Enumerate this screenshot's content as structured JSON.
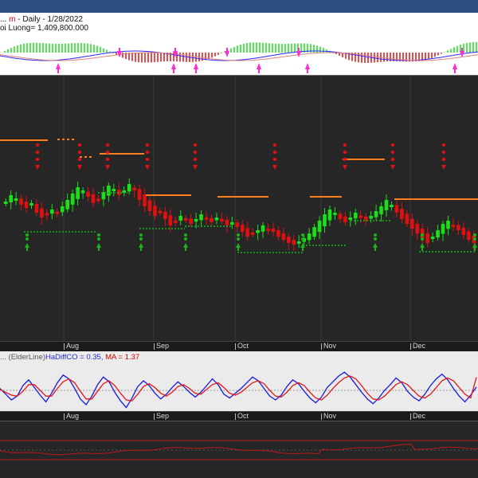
{
  "header": {
    "title_prefix": "... ",
    "symbol_fragment": "m",
    "title_rest": " - Daily - 1/28/2022",
    "volume_text": "oi Luong= 1,409,800.000"
  },
  "oscillator": {
    "name_fragment": "... (ElderLine)",
    "hadiffco_text": "HaDiffCO = 0.35, ",
    "ma_text": "MA = 1.37"
  },
  "x_axis": {
    "months": [
      {
        "label": "Aug",
        "month": "2021-08"
      },
      {
        "label": "Sep",
        "month": "2021-09"
      },
      {
        "label": "Oct",
        "month": "2021-10"
      },
      {
        "label": "Nov",
        "month": "2021-11"
      },
      {
        "label": "Dec",
        "month": "2021-12"
      }
    ]
  },
  "colors": {
    "up_candle": "#19e019",
    "down_candle": "#e01010",
    "resistance": "#ff7f1e",
    "support": "#18b418",
    "arrow_top": "#ff2bd9",
    "osc_line": "#1818e0",
    "osc_ma": "#e01818",
    "bottom_line": "#c01818"
  },
  "chart_data": [
    {
      "type": "candlestick",
      "title": "",
      "xlabel": "",
      "ylabel": "",
      "x_range": [
        "2021-07-12",
        "2022-01-28"
      ],
      "y_range_relative": [
        0.0,
        1.0
      ],
      "candles_close_relative": [
        0.51,
        0.55,
        0.53,
        0.49,
        0.47,
        0.5,
        0.44,
        0.41,
        0.43,
        0.46,
        0.44,
        0.48,
        0.52,
        0.56,
        0.6,
        0.58,
        0.54,
        0.5,
        0.52,
        0.57,
        0.61,
        0.59,
        0.55,
        0.58,
        0.62,
        0.58,
        0.52,
        0.48,
        0.45,
        0.42,
        0.44,
        0.4,
        0.36,
        0.39,
        0.42,
        0.4,
        0.37,
        0.4,
        0.43,
        0.4,
        0.38,
        0.41,
        0.39,
        0.36,
        0.38,
        0.35,
        0.32,
        0.29,
        0.31,
        0.33,
        0.36,
        0.34,
        0.32,
        0.29,
        0.27,
        0.25,
        0.24,
        0.26,
        0.28,
        0.31,
        0.35,
        0.39,
        0.43,
        0.46,
        0.44,
        0.4,
        0.38,
        0.41,
        0.44,
        0.41,
        0.39,
        0.42,
        0.45,
        0.48,
        0.52,
        0.49,
        0.44,
        0.4,
        0.37,
        0.34,
        0.31,
        0.28,
        0.25,
        0.29,
        0.33,
        0.37,
        0.39,
        0.36,
        0.33,
        0.3,
        0.27,
        0.25
      ],
      "notes": "Daily Heikin-Ashi style candles with step resistance (orange) and support (green) levels; magenta sell/buy arrows in top panel."
    },
    {
      "type": "line",
      "series": [
        {
          "name": "HaDiffCO",
          "values": [
            0.2,
            -0.4,
            -1.0,
            -0.6,
            0.5,
            1.1,
            0.3,
            -0.5,
            -1.2,
            -0.3,
            0.8,
            1.6,
            1.2,
            0.2,
            -0.9,
            -1.5,
            -0.6,
            0.6,
            1.4,
            0.9,
            -0.2,
            -1.1,
            -1.8,
            -0.8,
            0.4,
            1.0,
            0.5,
            -0.3,
            -0.9,
            -0.4,
            0.3,
            0.9,
            0.4,
            -0.2,
            -0.7,
            -0.2,
            0.5,
            1.2,
            0.6,
            -0.4,
            -0.8,
            -0.3,
            0.2,
            0.8,
            1.4,
            1.0,
            0.2,
            -0.6,
            -1.0,
            -0.5,
            0.4,
            1.1,
            0.7,
            -0.1,
            -0.8,
            -1.3,
            -0.7,
            0.3,
            0.9,
            1.5,
            1.9,
            1.4,
            0.6,
            -0.2,
            -0.9,
            -1.4,
            -0.8,
            0.0,
            0.6,
            1.3,
            0.8,
            -0.1,
            -0.7,
            -1.1,
            -0.4,
            0.5,
            1.2,
            1.7,
            1.1,
            0.2,
            -0.6,
            -1.2,
            -0.5,
            0.35
          ]
        },
        {
          "name": "MA",
          "values": [
            0.1,
            -0.2,
            -0.5,
            -0.6,
            -0.1,
            0.6,
            0.6,
            0.0,
            -0.6,
            -0.6,
            0.2,
            0.9,
            1.2,
            0.8,
            -0.1,
            -0.9,
            -0.9,
            -0.1,
            0.7,
            1.0,
            0.5,
            -0.3,
            -1.0,
            -1.1,
            -0.4,
            0.4,
            0.7,
            0.3,
            -0.3,
            -0.6,
            -0.2,
            0.4,
            0.6,
            0.2,
            -0.3,
            -0.4,
            0.1,
            0.6,
            0.8,
            0.3,
            -0.3,
            -0.5,
            -0.2,
            0.3,
            0.8,
            1.0,
            0.7,
            0.0,
            -0.6,
            -0.7,
            -0.2,
            0.5,
            0.8,
            0.5,
            -0.2,
            -0.8,
            -1.0,
            -0.5,
            0.2,
            0.8,
            1.3,
            1.5,
            1.2,
            0.5,
            -0.3,
            -0.9,
            -1.0,
            -0.6,
            0.0,
            0.6,
            0.9,
            0.6,
            0.0,
            -0.6,
            -0.8,
            -0.4,
            0.3,
            1.0,
            1.3,
            1.0,
            0.3,
            -0.4,
            -0.8,
            1.37
          ]
        }
      ]
    }
  ]
}
